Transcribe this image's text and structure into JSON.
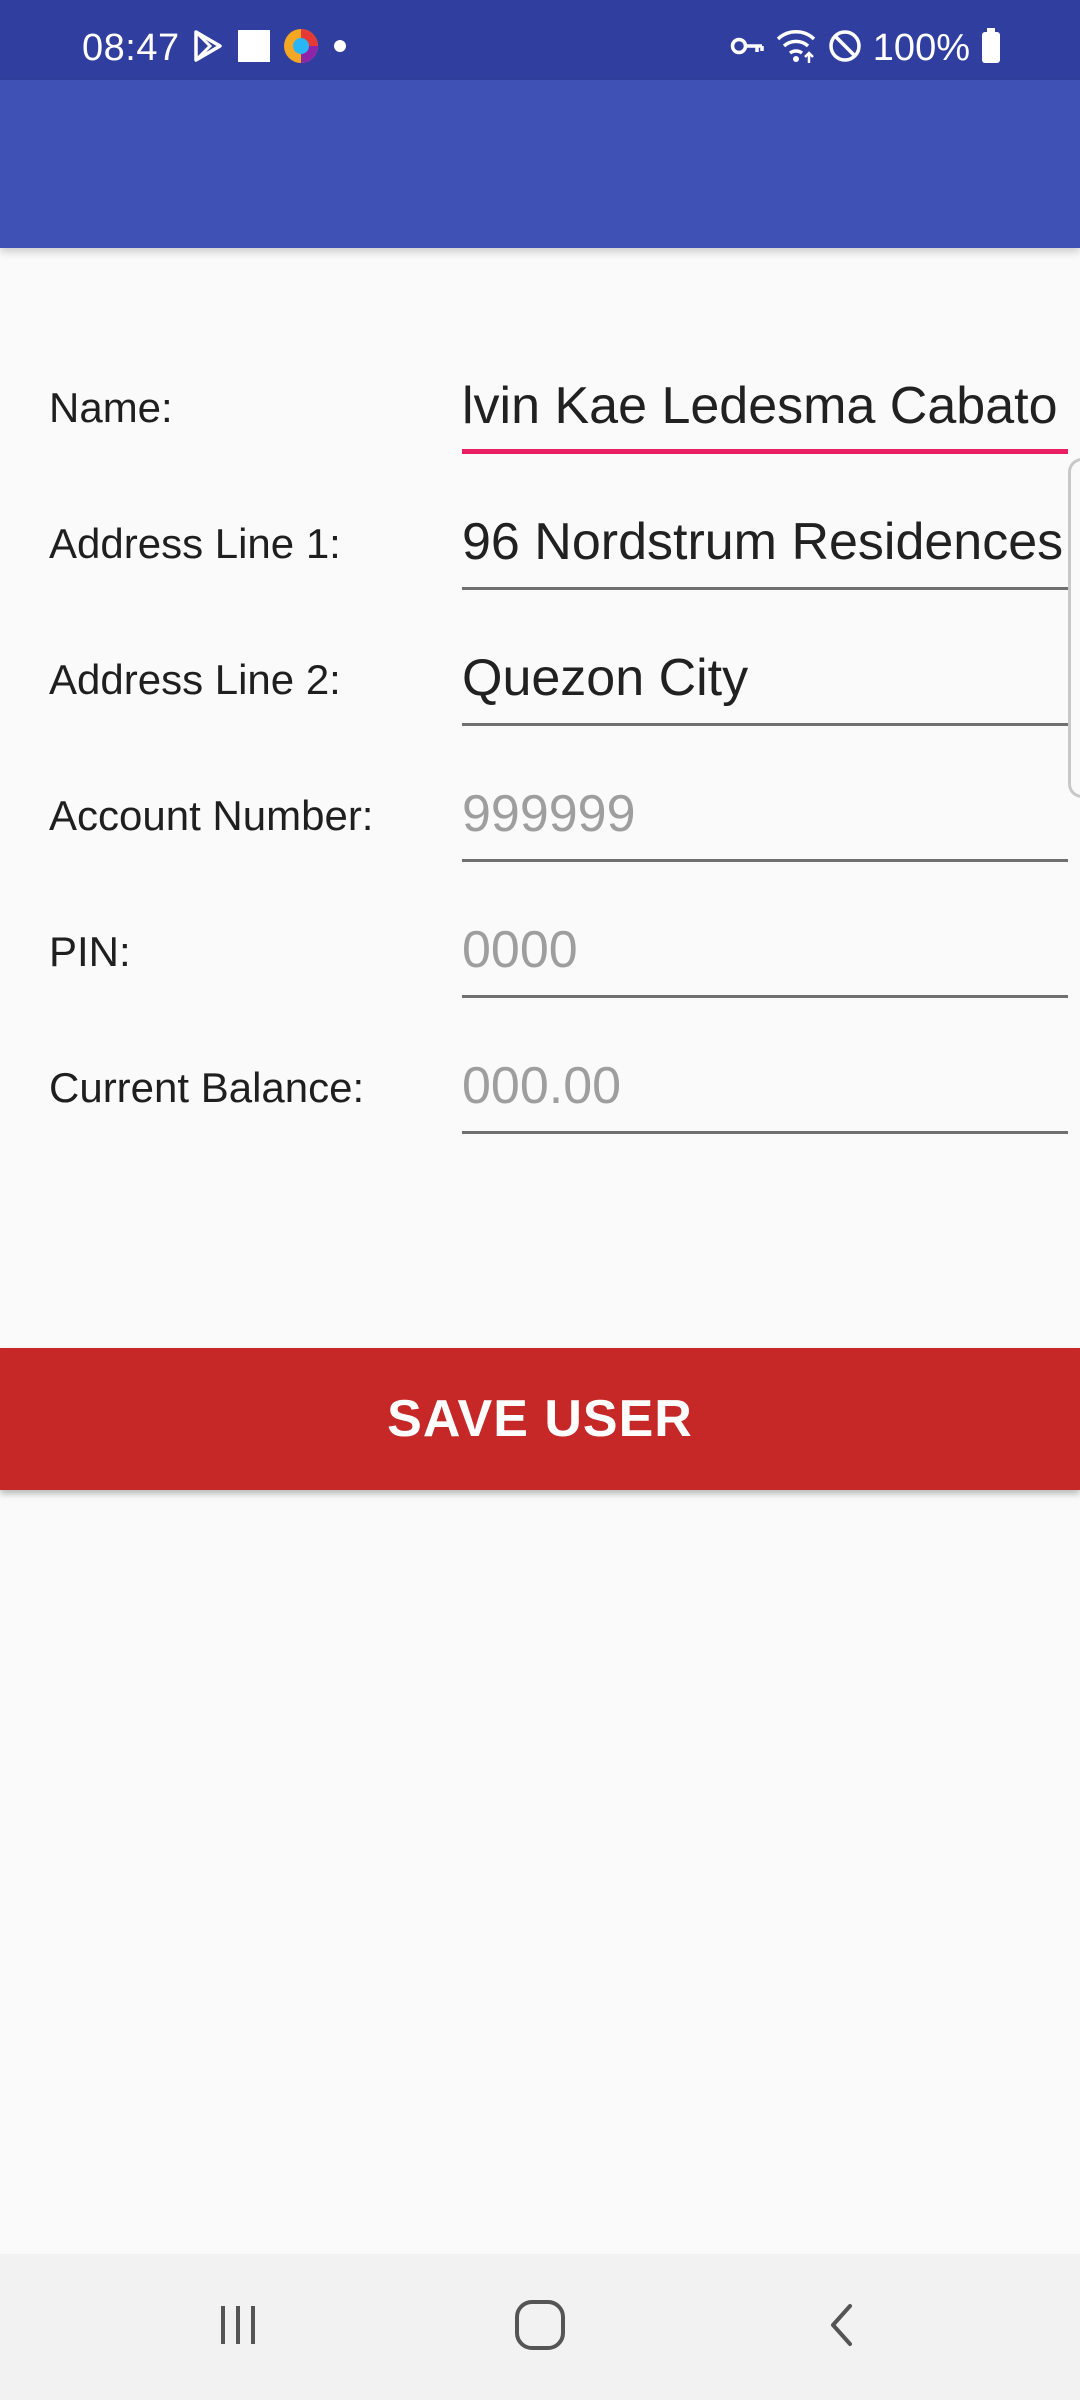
{
  "status_bar": {
    "time": "08:47",
    "battery_text": "100%",
    "left_icons": [
      "play-store-icon",
      "square-notification-icon",
      "app-notification-icon",
      "dot-icon"
    ],
    "right_icons": [
      "vpn-key-icon",
      "wifi-icon",
      "do-not-disturb-icon",
      "battery-icon"
    ]
  },
  "app_bar": {
    "title": ""
  },
  "form": {
    "fields": [
      {
        "label": "Name:",
        "value": "lvin Kae Ledesma Cabato",
        "placeholder": "",
        "focused": true
      },
      {
        "label": "Address Line 1:",
        "value": "96 Nordstrum Residences",
        "placeholder": ""
      },
      {
        "label": "Address Line 2:",
        "value": "Quezon City",
        "placeholder": ""
      },
      {
        "label": "Account Number:",
        "value": "",
        "placeholder": "999999"
      },
      {
        "label": "PIN:",
        "value": "",
        "placeholder": "0000"
      },
      {
        "label": "Current Balance:",
        "value": "",
        "placeholder": "000.00"
      }
    ]
  },
  "save_button": {
    "label": "SAVE USER"
  },
  "nav_bar": {
    "buttons": [
      "recents-icon",
      "home-icon",
      "back-icon"
    ]
  },
  "colors": {
    "status_bar": "#303f9f",
    "app_bar": "#3f51b5",
    "accent_focus": "#e91e63",
    "save_button": "#c62828",
    "background": "#fafafa"
  }
}
